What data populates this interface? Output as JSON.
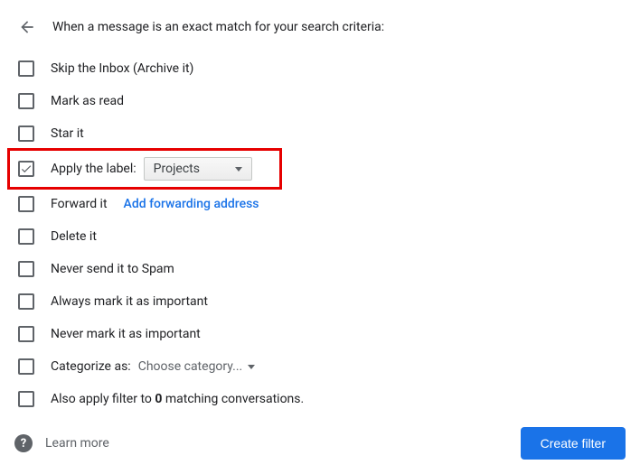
{
  "header": {
    "title": "When a message is an exact match for your search criteria:"
  },
  "options": {
    "skip_inbox": "Skip the Inbox (Archive it)",
    "mark_read": "Mark as read",
    "star": "Star it",
    "apply_label": "Apply the label:",
    "apply_label_value": "Projects",
    "forward": "Forward it",
    "forward_link": "Add forwarding address",
    "delete": "Delete it",
    "never_spam": "Never send it to Spam",
    "always_important": "Always mark it as important",
    "never_important": "Never mark it as important",
    "categorize": "Categorize as:",
    "categorize_value": "Choose category...",
    "also_apply_prefix": "Also apply filter to ",
    "also_apply_count": "0",
    "also_apply_suffix": " matching conversations."
  },
  "footer": {
    "learn_more": "Learn more",
    "create_button": "Create filter"
  }
}
